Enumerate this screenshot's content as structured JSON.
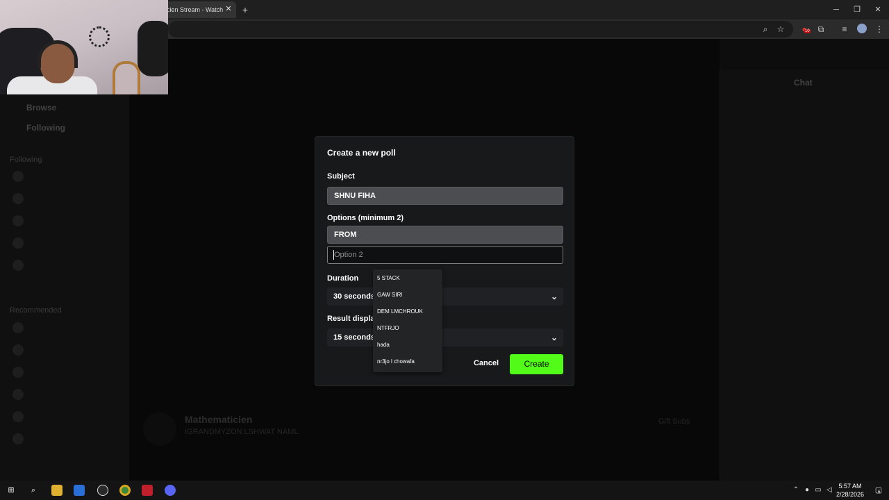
{
  "browser": {
    "tab_title": "cien Stream - Watch",
    "tab_close": "✕",
    "new_tab": "+",
    "window": {
      "minimize": "─",
      "restore": "❐",
      "close": "✕"
    },
    "toolbar_icons": [
      "zoom-icon",
      "star-icon",
      "extension-badge-icon",
      "puzzle-icon",
      "media-icon",
      "profile-icon",
      "menu-icon"
    ],
    "extension_badge": "10"
  },
  "background_page": {
    "sidebar_nav": [
      "Browse",
      "Following"
    ],
    "sidebar_section": "Following",
    "sidebar_section2": "Recommended",
    "streamer_name": "Mathematicien",
    "stream_title": "IGRANDMYZON LSHWAT NAML",
    "gift_subs": "Gift Subs",
    "chat_title": "Chat"
  },
  "modal": {
    "title": "Create a new poll",
    "subject_label": "Subject",
    "subject_value": "SHNU FIHA",
    "options_label": "Options (minimum 2)",
    "option1_value": "FROM",
    "option2_placeholder": "Option 2",
    "duration_label": "Duration",
    "duration_value": "30 seconds",
    "result_label": "Result display",
    "result_label_visible": "Result displa",
    "result_value": "15 seconds",
    "cancel_label": "Cancel",
    "create_label": "Create",
    "accent_color": "#53fc18"
  },
  "autocomplete": {
    "items": [
      "5 STACK",
      "GAW SIRI",
      "DEM LMCHROUK",
      "NTFRJO",
      "hada",
      "nr3jo l chowafa"
    ]
  },
  "taskbar": {
    "apps": [
      "windows-start-icon",
      "search-icon",
      "file-explorer-icon",
      "store-icon",
      "app-icon",
      "chrome-icon",
      "red-app-icon",
      "discord-icon"
    ],
    "time": "5:57 AM",
    "date": "2/28/2026",
    "notification_count": "6"
  }
}
